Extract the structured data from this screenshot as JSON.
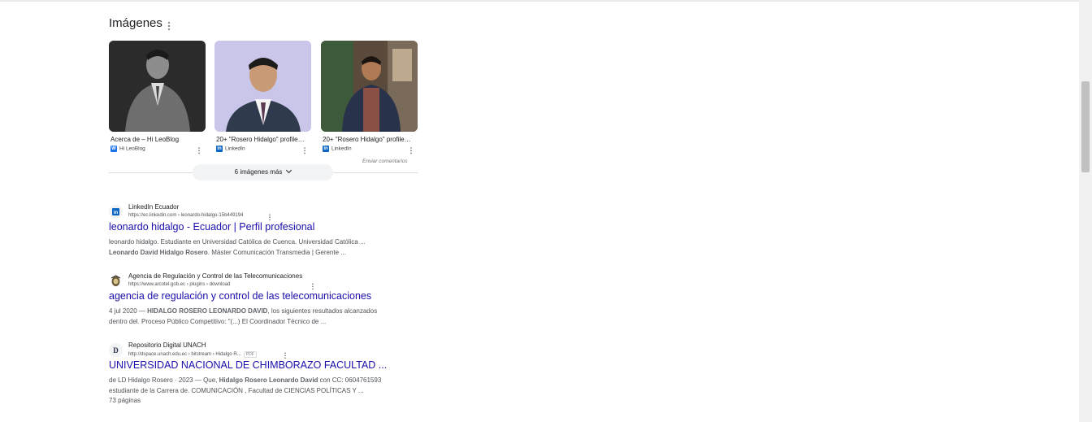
{
  "images_section": {
    "title": "Imágenes",
    "cards": [
      {
        "title": "Acerca de – Hi LeoBlog",
        "source": "Hi LeoBlog",
        "source_color": "#1a73e8",
        "source_icon": "wordpress-icon"
      },
      {
        "title": "20+ \"Rosero Hidalgo\" profiles ...",
        "source": "LinkedIn",
        "source_color": "#0a66c2",
        "source_icon": "linkedin-icon"
      },
      {
        "title": "20+ \"Rosero Hidalgo\" profiles ...",
        "source": "LinkedIn",
        "source_color": "#0a66c2",
        "source_icon": "linkedin-icon"
      }
    ],
    "feedback": "Enviar comentarios",
    "more_button": "6 imágenes más"
  },
  "results": [
    {
      "site": "LinkedIn Ecuador",
      "url": "https://ec.linkedin.com › leonardo-hidalgo-15b449194",
      "title": "leonardo hidalgo - Ecuador | Perfil profesional",
      "snippet_line1": "leonardo hidalgo. Estudiante en Universidad Católica de Cuenca. Universidad Católica ...",
      "snippet_line2_bold": "Leonardo David Hidalgo Rosero",
      "snippet_line2_rest": ". Máster Comunicación Transmedia | Gerente ..."
    },
    {
      "site": "Agencia de Regulación y Control de las Telecomunicaciones",
      "url": "https://www.arcotel.gob.ec › plugins › download",
      "title": "agencia de regulación y control de las telecomunicaciones",
      "snippet_date": "4 jul 2020 — ",
      "snippet_bold": "HIDALGO ROSERO LEONARDO DAVID",
      "snippet_rest": ", los siguientes resultados alcanzados",
      "snippet_line2": "dentro del. Proceso Público Competitivo: \"(...) El Coordinador Técnico de ..."
    },
    {
      "site": "Repositorio Digital UNACH",
      "url": "http://dspace.unach.edu.ec › bitstream › Hidalgo R...",
      "pdf_badge": "PDF",
      "title": "UNIVERSIDAD NACIONAL DE CHIMBORAZO FACULTAD ...",
      "snippet_meta": "de LD Hidalgo Rosero · 2023 — Que, ",
      "snippet_bold": "Hidalgo Rosero Leonardo David",
      "snippet_rest": " con CC: 0604761593",
      "snippet_line2": "estudiante de la Carrera de. COMUNICACIÓN , Facultad de CIENCIAS POLÍTICAS Y ...",
      "pages": "73 páginas"
    }
  ]
}
